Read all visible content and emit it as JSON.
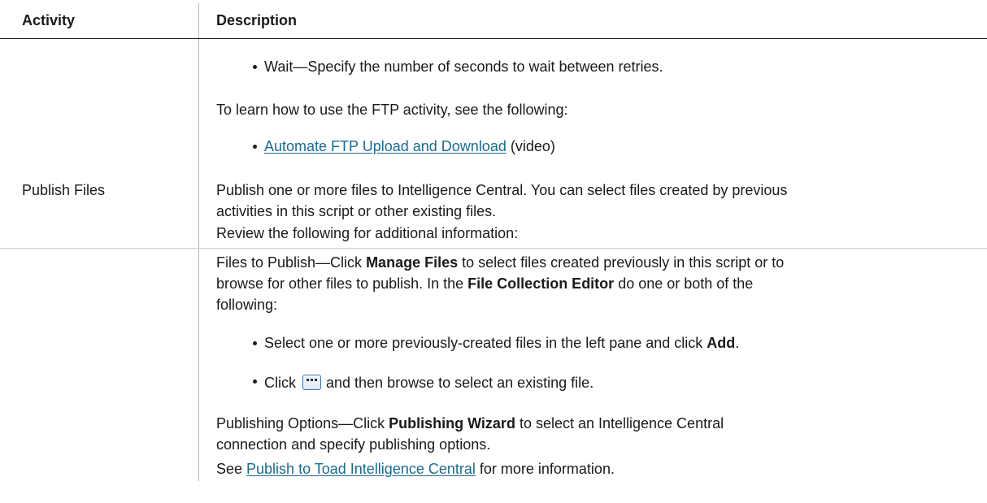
{
  "header": {
    "col1": "Activity",
    "col2": "Description"
  },
  "ftp_row": {
    "wait_bullet": "Wait—Specify the number of seconds to wait between retries.",
    "learn_text": "To learn how to use the FTP activity, see the following:",
    "video_link": "Automate FTP Upload and Download",
    "video_suffix": " (video)"
  },
  "publish_row": {
    "activity": "Publish Files",
    "desc_line1": "Publish one or more files to Intelligence Central. You can select files created by previous",
    "desc_line2": "activities in this script or other existing files.",
    "review_text": "Review the following for additional information:",
    "files_line1_pre": "Files to Publish—Click ",
    "files_line1_bold": "Manage Files",
    "files_line1_post": " to select files created previously in this script or to",
    "files_line2_pre": "browse for other files to publish. In the ",
    "files_line2_bold": "File Collection Editor",
    "files_line2_post": " do one or both of the",
    "files_line3": "following:",
    "bullet1_pre": "Select one or more previously-created files in the left pane and click ",
    "bullet1_bold": "Add",
    "bullet1_post": ".",
    "bullet2_pre": "Click ",
    "bullet2_post": " and then browse to select an existing file.",
    "ellipsis_icon": "ellipsis-button-icon",
    "options_line1_pre": "Publishing Options—Click ",
    "options_line1_bold": "Publishing Wizard",
    "options_line1_post": " to select an Intelligence Central",
    "options_line2": "connection and specify publishing options.",
    "see_pre": "See ",
    "see_link": "Publish to Toad Intelligence Central",
    "see_post": " for more information."
  }
}
